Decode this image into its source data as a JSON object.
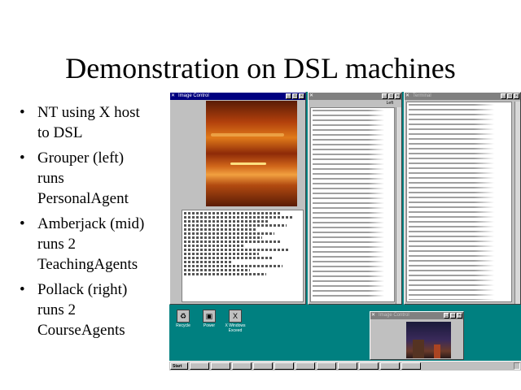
{
  "slide": {
    "title": "Demonstration on DSL machines",
    "bullets": [
      {
        "text": "NT using X host\nto DSL"
      },
      {
        "text": "Grouper (left)\nruns\nPersonalAgent"
      },
      {
        "text": "Amberjack (mid)\nruns 2\nTeachingAgents"
      },
      {
        "text": "Pollack (right)\nruns 2\nCourseAgents"
      }
    ]
  },
  "screenshot": {
    "image_window_1": {
      "title": "Image Control"
    },
    "image_window_2": {
      "title": "Image Control"
    },
    "term_mid": {
      "title": "",
      "menu_left": "Left"
    },
    "term_right": {
      "title": "Terminal"
    },
    "desktop_icons": [
      {
        "label": "Recycle",
        "icon": "recycle-bin-icon"
      },
      {
        "label": "Power",
        "icon": "computer-icon"
      },
      {
        "label": "X Windows Exceed",
        "icon": "x-server-icon"
      }
    ],
    "taskbar": {
      "start_label": "Start",
      "tasks": [
        "",
        "",
        "",
        "",
        "",
        "",
        "",
        "",
        "",
        "",
        "",
        ""
      ],
      "clock": ""
    },
    "colors": {
      "desktop": "#008080",
      "titlebar": "#000080"
    }
  }
}
